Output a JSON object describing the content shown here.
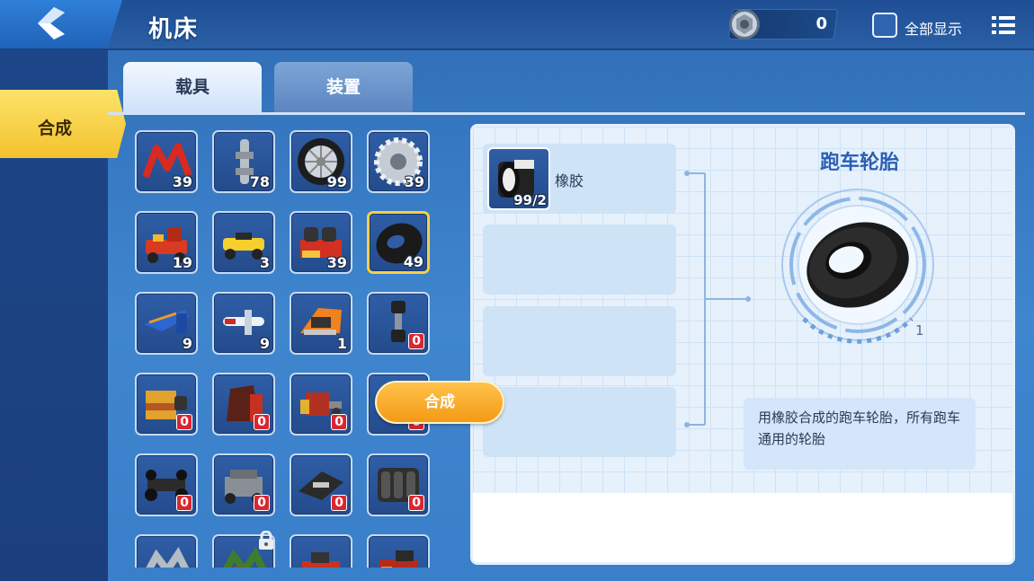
{
  "header": {
    "title": "机床",
    "currency_value": "0",
    "show_all_label": "全部显示"
  },
  "sidebar": {
    "items": [
      {
        "label": "合成"
      }
    ]
  },
  "tabs": [
    {
      "label": "载具",
      "active": true
    },
    {
      "label": "装置",
      "active": false
    }
  ],
  "grid": {
    "items": [
      {
        "icon": "red-frame-part",
        "count": "39"
      },
      {
        "icon": "gray-axle-part",
        "count": "78"
      },
      {
        "icon": "wheel-rim-part",
        "count": "99"
      },
      {
        "icon": "gear-part",
        "count": "39"
      },
      {
        "icon": "red-car",
        "count": "19"
      },
      {
        "icon": "yellow-car",
        "count": "3"
      },
      {
        "icon": "engine-block",
        "count": "39"
      },
      {
        "icon": "sports-tire",
        "count": "49",
        "selected": true
      },
      {
        "icon": "blue-jet",
        "count": "9"
      },
      {
        "icon": "white-plane",
        "count": "9"
      },
      {
        "icon": "orange-racer",
        "count": "1"
      },
      {
        "icon": "dumbbell-part",
        "count": "0"
      },
      {
        "icon": "yellow-box-engine",
        "count": "0"
      },
      {
        "icon": "red-seat",
        "count": "0"
      },
      {
        "icon": "red-engine",
        "count": "0"
      },
      {
        "icon": "yellow-buggy",
        "count": "0"
      },
      {
        "icon": "black-chassis",
        "count": "0"
      },
      {
        "icon": "gray-engine",
        "count": "0"
      },
      {
        "icon": "black-frame",
        "count": "0"
      },
      {
        "icon": "black-block-engine",
        "count": "0"
      },
      {
        "icon": "gray-frame-part",
        "count": ""
      },
      {
        "icon": "green-frame-part",
        "count": "",
        "locked": true
      },
      {
        "icon": "red-vehicle",
        "count": ""
      },
      {
        "icon": "red-dark-vehicle",
        "count": ""
      }
    ]
  },
  "recipe": {
    "materials": [
      {
        "name": "橡胶",
        "count": "99/2",
        "icon": "rubber-roll-icon"
      }
    ],
    "product": {
      "name": "跑车轮胎",
      "count": "1",
      "icon": "sports-tire-icon",
      "description": "用橡胶合成的跑车轮胎，所有跑车通用的轮胎"
    },
    "craft_label": "合成"
  },
  "colors": {
    "accent_yellow": "#f7cf45",
    "craft_orange": "#f49a16",
    "title_blue": "#2b5fb4",
    "badge_red": "#d9272f"
  }
}
